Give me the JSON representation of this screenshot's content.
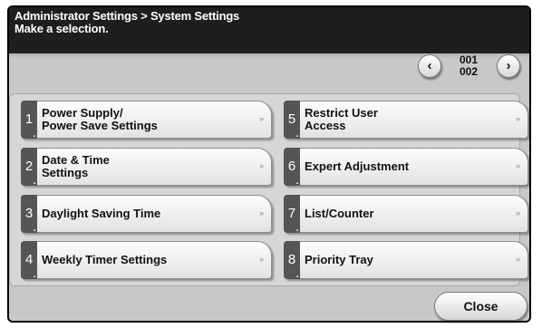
{
  "header": {
    "breadcrumb": "Administrator Settings > System Settings",
    "instruction": "Make a selection."
  },
  "pagination": {
    "prev_icon": "‹",
    "next_icon": "›",
    "current_page": "001",
    "total_pages": "002"
  },
  "menu": {
    "items": [
      {
        "number": "1",
        "label": "Power Supply/\nPower Save Settings",
        "arrow": "»"
      },
      {
        "number": "2",
        "label": "Date & Time\nSettings",
        "arrow": "»"
      },
      {
        "number": "3",
        "label": "Daylight Saving Time",
        "arrow": "»"
      },
      {
        "number": "4",
        "label": "Weekly Timer Settings",
        "arrow": "»"
      },
      {
        "number": "5",
        "label": "Restrict User\nAccess",
        "arrow": "»"
      },
      {
        "number": "6",
        "label": "Expert Adjustment",
        "arrow": "»"
      },
      {
        "number": "7",
        "label": "List/Counter",
        "arrow": "»"
      },
      {
        "number": "8",
        "label": "Priority Tray",
        "arrow": "»"
      }
    ]
  },
  "footer": {
    "close_label": "Close"
  },
  "colors": {
    "header_bg": "#1e1e1e",
    "panel_bg": "#c8c8c8",
    "number_tab_bg": "#555555"
  }
}
